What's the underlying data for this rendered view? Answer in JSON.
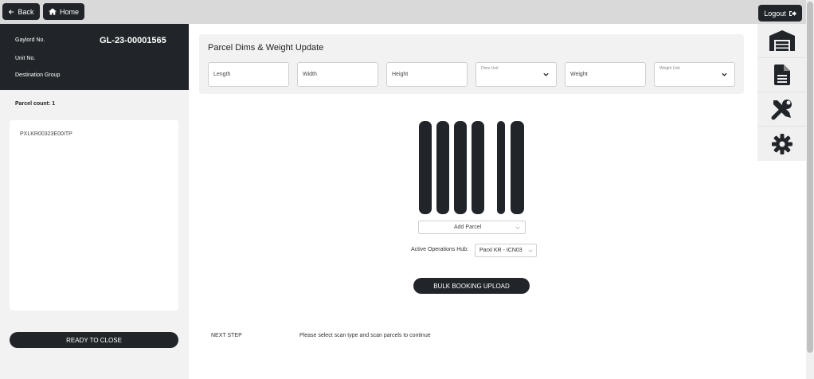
{
  "topbar": {
    "back_label": "Back",
    "home_label": "Home",
    "logout_label": "Logout",
    "icons": {
      "back": "arrow-left-icon",
      "home": "home-icon",
      "logout": "logout-icon"
    }
  },
  "left_header": {
    "gaylord_label": "Gaylord No.",
    "gaylord_value": "GL-23-00001565",
    "unit_label": "Unit No.",
    "destination_label": "Destination Group"
  },
  "left_panel": {
    "parcel_count": "Parcel count: 1",
    "parcels": [
      "PXLKR00323E00ITP"
    ],
    "ready_button": "READY TO CLOSE"
  },
  "dims": {
    "title": "Parcel Dims & Weight Update",
    "length_placeholder": "Length",
    "width_placeholder": "Width",
    "height_placeholder": "Height",
    "dims_unit_label": "Dims Unit",
    "weight_placeholder": "Weight",
    "weight_unit_label": "Weight Unit"
  },
  "scan": {
    "barcode_icon": "barcode-icon",
    "add_parcel_label": "Add Parcel",
    "hub_label": "Active Operations Hub:",
    "hub_value": "Parxl KR - ICN03",
    "bulk_button": "BULK BOOKING UPLOAD"
  },
  "footer": {
    "next_step_label": "NEXT STEP",
    "next_step_message": "Please select scan type and scan parcels to continue"
  },
  "right_rail": {
    "items": [
      "warehouse-icon",
      "document-icon",
      "tools-icon",
      "gear-icon"
    ]
  },
  "colors": {
    "dark": "#212529",
    "panel": "#f2f2f2",
    "topbar": "#d9d9d9"
  }
}
